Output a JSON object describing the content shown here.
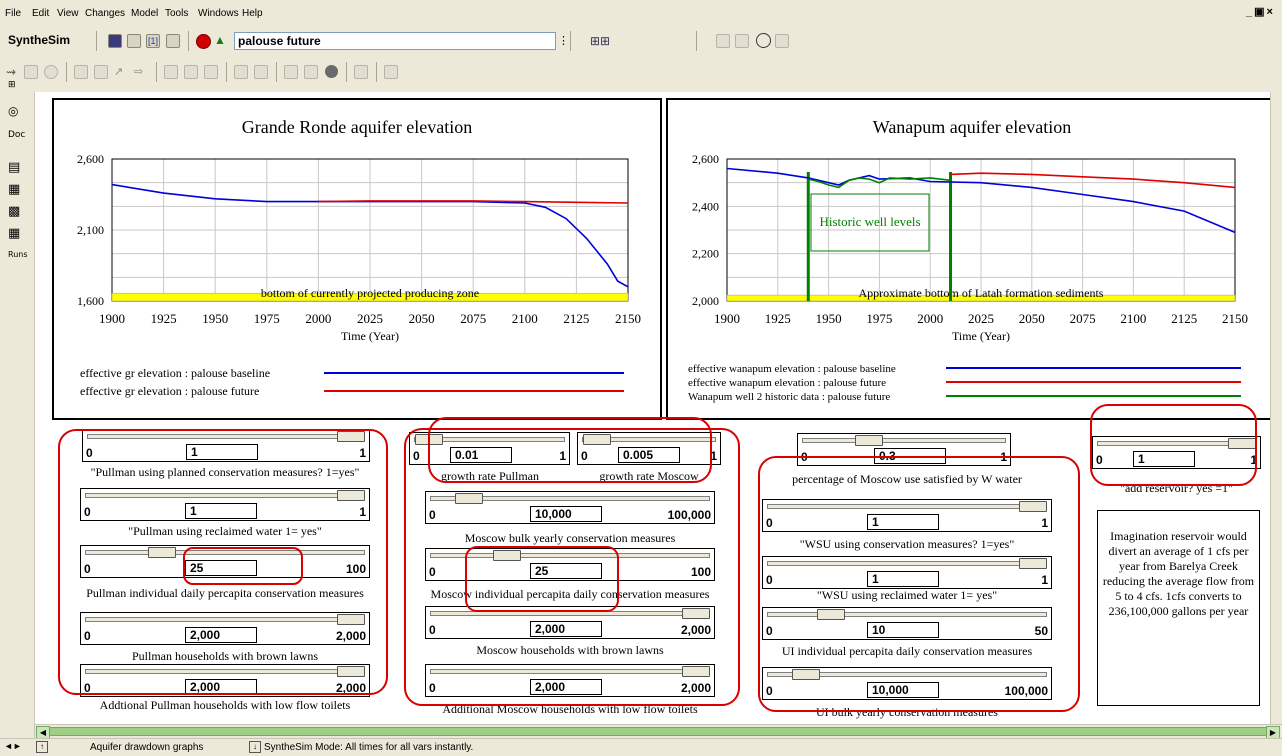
{
  "menu": [
    "File",
    "Edit",
    "View",
    "Changes",
    "Model",
    "Tools",
    "Windows",
    "Help"
  ],
  "toolbar": {
    "app_name": "SyntheSim",
    "run_name": "palouse future"
  },
  "sidebar": {
    "doc_label": "Doc",
    "runs_label": "Runs"
  },
  "status": {
    "left": "Aquifer drawdown graphs",
    "right": "SyntheSim Mode: All times for all vars instantly."
  },
  "colors": {
    "baseline": "#0000dd",
    "future": "#e00000",
    "historic": "#008000",
    "band": "#ffff00"
  },
  "charts": {
    "gr": {
      "title": "Grande Ronde aquifer elevation",
      "xlabel": "Time (Year)",
      "ytick_labels": [
        "2,600",
        "2,100",
        "1,600"
      ],
      "xtick_labels": [
        "1900",
        "1925",
        "1950",
        "1975",
        "2000",
        "2025",
        "2050",
        "2075",
        "2100",
        "2125",
        "2150"
      ],
      "band_label": "bottom of currently projected producing zone",
      "legend": [
        "effective gr elevation : palouse baseline",
        "effective gr elevation : palouse future"
      ]
    },
    "wa": {
      "title": "Wanapum aquifer elevation",
      "xlabel": "Time (Year)",
      "ytick_labels": [
        "2,600",
        "2,400",
        "2,200",
        "2,000"
      ],
      "xtick_labels": [
        "1900",
        "1925",
        "1950",
        "1975",
        "2000",
        "2025",
        "2050",
        "2075",
        "2100",
        "2125",
        "2150"
      ],
      "band_label": "Approximate bottom of Latah formation sediments",
      "inset_label": "Historic well levels",
      "legend": [
        "effective wanapum elevation : palouse baseline",
        "effective wanapum elevation : palouse future",
        "Wanapum well 2 historic data : palouse future"
      ]
    }
  },
  "chart_data": [
    {
      "type": "line",
      "title": "Grande Ronde aquifer elevation",
      "xlabel": "Time (Year)",
      "ylabel": "",
      "xlim": [
        1900,
        2150
      ],
      "ylim": [
        1600,
        2600
      ],
      "grid": true,
      "legend_position": "bottom",
      "band": {
        "y": [
          1600,
          1655
        ],
        "label": "bottom of currently projected producing zone",
        "color": "#ffff00"
      },
      "series": [
        {
          "name": "effective gr elevation : palouse baseline",
          "color": "#0000dd",
          "x": [
            1900,
            1925,
            1950,
            1975,
            2000,
            2025,
            2050,
            2075,
            2100,
            2110,
            2120,
            2130,
            2140,
            2145,
            2150
          ],
          "y": [
            2420,
            2360,
            2320,
            2300,
            2300,
            2300,
            2300,
            2300,
            2290,
            2260,
            2180,
            2040,
            1860,
            1740,
            1700
          ]
        },
        {
          "name": "effective gr elevation : palouse future",
          "color": "#e00000",
          "x": [
            2000,
            2025,
            2050,
            2075,
            2100,
            2125,
            2150
          ],
          "y": [
            2300,
            2305,
            2305,
            2305,
            2300,
            2295,
            2290
          ]
        }
      ]
    },
    {
      "type": "line",
      "title": "Wanapum aquifer elevation",
      "xlabel": "Time (Year)",
      "ylabel": "",
      "xlim": [
        1900,
        2150
      ],
      "ylim": [
        2000,
        2600
      ],
      "grid": true,
      "legend_position": "bottom",
      "band": {
        "y": [
          2000,
          2025
        ],
        "label": "Approximate bottom of Latah formation sediments",
        "color": "#ffff00"
      },
      "series": [
        {
          "name": "effective wanapum elevation : palouse baseline",
          "color": "#0000dd",
          "x": [
            1900,
            1925,
            1940,
            1950,
            1955,
            1960,
            1970,
            1975,
            1990,
            2000,
            2025,
            2050,
            2075,
            2100,
            2125,
            2150
          ],
          "y": [
            2560,
            2540,
            2520,
            2500,
            2490,
            2510,
            2530,
            2515,
            2520,
            2505,
            2500,
            2480,
            2450,
            2420,
            2380,
            2290
          ]
        },
        {
          "name": "effective wanapum elevation : palouse future",
          "color": "#e00000",
          "x": [
            2010,
            2025,
            2050,
            2075,
            2100,
            2125,
            2150
          ],
          "y": [
            2535,
            2540,
            2535,
            2525,
            2515,
            2500,
            2480
          ]
        },
        {
          "name": "Wanapum well 2 historic data : palouse future",
          "color": "#008000",
          "x": [
            1940,
            1945,
            1950,
            1955,
            1960,
            1965,
            1970,
            1975,
            1980,
            1990,
            2000,
            2010
          ],
          "y": [
            2515,
            2505,
            2490,
            2480,
            2510,
            2520,
            2515,
            2500,
            2520,
            2515,
            2520,
            2510
          ]
        }
      ]
    }
  ],
  "sliders": [
    {
      "id": "pullman-conservation",
      "min": "0",
      "max": "1",
      "value": "1",
      "level": 1.0,
      "label": "\"Pullman using planned conservation measures? 1=yes\""
    },
    {
      "id": "pullman-reclaimed",
      "min": "0",
      "max": "1",
      "value": "1",
      "level": 1.0,
      "label": "\"Pullman using reclaimed water 1= yes\""
    },
    {
      "id": "pullman-percapita",
      "min": "0",
      "max": "100",
      "value": "25",
      "level": 0.25,
      "label": "Pullman individual daily percapita conservation measures"
    },
    {
      "id": "pullman-brown-lawns",
      "min": "0",
      "max": "2,000",
      "value": "2,000",
      "level": 1.0,
      "label": "Pullman households with brown lawns"
    },
    {
      "id": "pullman-low-flow",
      "min": "0",
      "max": "2,000",
      "value": "2,000",
      "level": 1.0,
      "label": "Addtional Pullman households with low flow toilets"
    },
    {
      "id": "growth-pullman",
      "min": "0",
      "max": "1",
      "value": "0.01",
      "level": 0.01,
      "label": "growth rate Pullman"
    },
    {
      "id": "growth-moscow",
      "min": "0",
      "max": "1",
      "value": "0.005",
      "level": 0.005,
      "label": "growth rate Moscow"
    },
    {
      "id": "moscow-bulk",
      "min": "0",
      "max": "100,000",
      "value": "10,000",
      "level": 0.1,
      "label": "Moscow bulk yearly conservation measures"
    },
    {
      "id": "moscow-percapita",
      "min": "0",
      "max": "100",
      "value": "25",
      "level": 0.25,
      "label": "Moscow individual percapita daily conservation measures"
    },
    {
      "id": "moscow-brown-lawns",
      "min": "0",
      "max": "2,000",
      "value": "2,000",
      "level": 1.0,
      "label": "Moscow households with brown lawns"
    },
    {
      "id": "moscow-low-flow",
      "min": "0",
      "max": "2,000",
      "value": "2,000",
      "level": 1.0,
      "label": "Additional Moscow households with low flow toilets"
    },
    {
      "id": "moscow-w-water",
      "min": "0",
      "max": "1",
      "value": "0.3",
      "level": 0.3,
      "label": "percentage of Moscow use satisfied by W water"
    },
    {
      "id": "wsu-conservation",
      "min": "0",
      "max": "1",
      "value": "1",
      "level": 1.0,
      "label": "\"WSU using conservation measures? 1=yes\""
    },
    {
      "id": "wsu-reclaimed",
      "min": "0",
      "max": "1",
      "value": "1",
      "level": 1.0,
      "label": "\"WSU using reclaimed water 1= yes\""
    },
    {
      "id": "ui-percapita",
      "min": "0",
      "max": "50",
      "value": "10",
      "level": 0.2,
      "label": "UI individual percapita daily conservation measures"
    },
    {
      "id": "ui-bulk",
      "min": "0",
      "max": "100,000",
      "value": "10,000",
      "level": 0.1,
      "label": "UI bulk yearly conservation measures"
    },
    {
      "id": "add-reservoir",
      "min": "0",
      "max": "1",
      "value": "1",
      "level": 1.0,
      "label": "\"add reservoir? yes =1\""
    }
  ],
  "note": "Imagination reservoir would divert an average of 1 cfs per year from Barelya Creek reducing the average flow from 5 to 4 cfs. 1cfs converts to 236,100,000 gallons per year"
}
